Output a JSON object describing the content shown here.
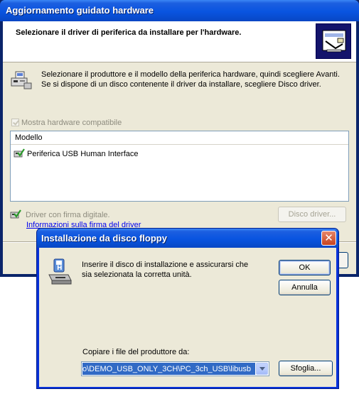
{
  "wizard": {
    "title": "Aggiornamento guidato hardware",
    "header": "Selezionare il driver di periferica da installare per l'hardware.",
    "description": "Selezionare il produttore e il modello della periferica hardware, quindi scegliere Avanti. Se si dispone di un disco contenente il driver da installare, scegliere Disco driver.",
    "show_compatible_label": "Mostra hardware compatibile",
    "model_column": "Modello",
    "models": [
      "Periferica USB Human Interface"
    ],
    "signed_driver_text": "Driver con firma digitale.",
    "signing_link": "Informazioni sulla firma del driver",
    "disk_button": "Disco driver..."
  },
  "dialog": {
    "title": "Installazione da disco floppy",
    "close_glyph": "✕",
    "message": "Inserire il disco di installazione e assicurarsi che sia selezionata la corretta unità.",
    "ok_label": "OK",
    "cancel_label": "Annulla",
    "copy_label": "Copiare i file del produttore da:",
    "path_value": "o\\DEMO_USB_ONLY_3CH\\PC_3ch_USB\\libusb",
    "browse_label": "Sfoglia..."
  }
}
